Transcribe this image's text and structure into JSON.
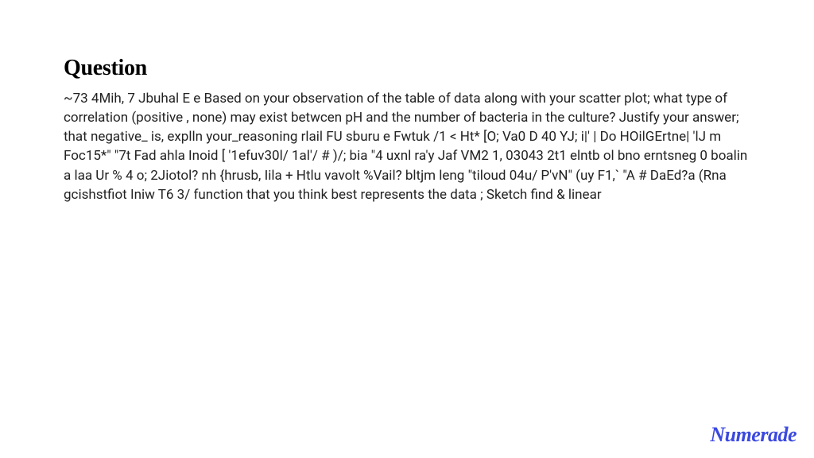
{
  "heading": "Question",
  "body": "~73 4Mih, 7 Jbuhal E e Based on your observation of the table of data along with your scatter plot; what type of correlation (positive , none) may exist betwcen pH and the number of bacteria in the culture? Justify your answer; that negative_ is, explln your_reasoning rlail FU sburu e Fwtuk /1 < Ht* [O; Va0 D 40 YJ; i|' | Do HOilGErtne| 'lJ m Foc15*\" \"7t Fad ahla Inoid [ '1efuv30l/ 1al'/ # )/; bia \"4 uxnl ra'y Jaf VM2 1, 03043 2t1 elntb ol bno erntsneg 0 boalin a laa Ur % 4 o; 2Jiotol? nh {hrusb, Iila + Htlu vavolt %Vail? bltjm leng \"tiloud 04u/ P'vN\" (uy F1,` \"A # DaEd?a (Rna gcishstfiot Iniw T6 3/ function that you think best represents the data ; Sketch find & linear",
  "brand": "Numerade"
}
